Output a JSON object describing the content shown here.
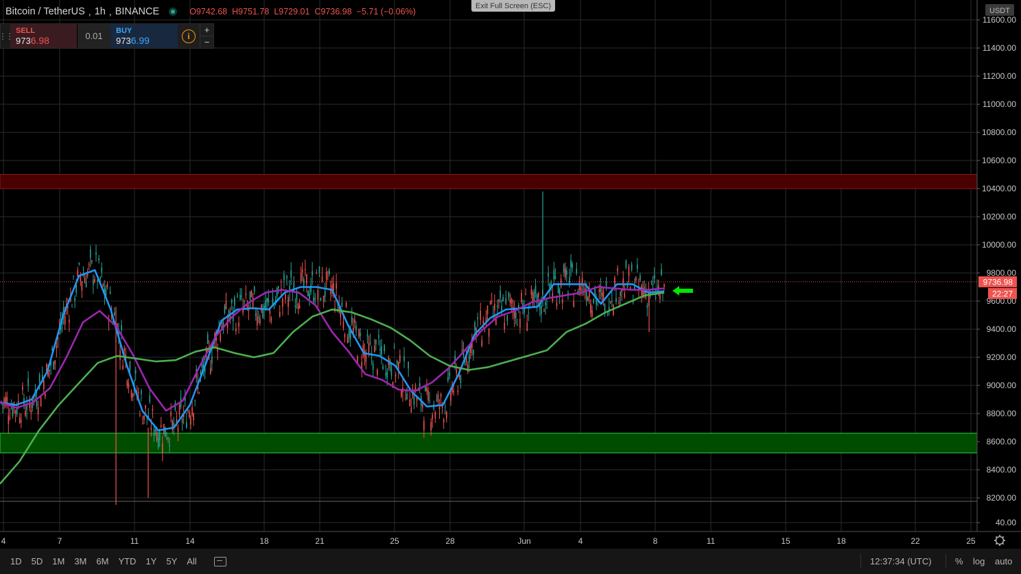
{
  "header": {
    "symbol": "Bitcoin / TetherUS",
    "interval": "1h",
    "exchange": "BINANCE",
    "ohlc": {
      "o_label": "O",
      "o": "9742.68",
      "h_label": "H",
      "h": "9751.78",
      "l_label": "L",
      "l": "9729.01",
      "c_label": "C",
      "c": "9736.98",
      "change": "−5.71 (−0.06%)"
    },
    "exit_fullscreen": "Exit Full Screen (ESC)"
  },
  "trade_panel": {
    "sell_label": "SELL",
    "sell_price_prefix": "973",
    "sell_price_suffix": "6.98",
    "quantity": "0.01",
    "buy_label": "BUY",
    "buy_price_prefix": "973",
    "buy_price_suffix": "6.99",
    "info_icon": "info-icon",
    "plus": "+",
    "minus": "−"
  },
  "price_axis": {
    "currency": "USDT",
    "current_price": "9736.98",
    "countdown": "22:27"
  },
  "bottom_bar": {
    "ranges": [
      "1D",
      "5D",
      "1M",
      "3M",
      "6M",
      "YTD",
      "1Y",
      "5Y",
      "All"
    ],
    "clock": "12:37:34 (UTC)",
    "percent": "%",
    "log": "log",
    "auto": "auto"
  },
  "colors": {
    "up": "#26a69a",
    "down": "#ef5350",
    "ma_fast": "#2196f3",
    "ma_mid": "#9c27b0",
    "ma_slow": "#4caf50",
    "resistance_zone": "#4a0000",
    "support_zone": "#004d00",
    "arrow": "#00e600"
  },
  "chart_data": {
    "type": "line",
    "ylim": [
      3820,
      11680
    ],
    "y_ticks": [
      "11600.00",
      "11400.00",
      "11200.00",
      "11000.00",
      "10800.00",
      "10600.00",
      "10400.00",
      "10200.00",
      "10000.00",
      "9800.00",
      "9600.00",
      "9400.00",
      "9200.00",
      "9000.00",
      "8800.00",
      "8600.00",
      "8400.00",
      "8200.00",
      "40.00"
    ],
    "x_ticks": [
      "4",
      "7",
      "11",
      "14",
      "18",
      "21",
      "25",
      "28",
      "Jun",
      "4",
      "8",
      "11",
      "15",
      "18",
      "22",
      "25"
    ],
    "zones": [
      {
        "from": 10400,
        "to": 10500,
        "type": "resistance"
      },
      {
        "from": 8520,
        "to": 8660,
        "type": "support"
      }
    ],
    "current_price": 9736.98,
    "series": [
      {
        "values": [
          8880,
          8860,
          8900,
          9100,
          9500,
          9780,
          9820,
          9540,
          9150,
          8820,
          8680,
          8700,
          8860,
          9150,
          9460,
          9540,
          9550,
          9540,
          9660,
          9700,
          9700,
          9680,
          9430,
          9230,
          9210,
          9140,
          8960,
          8850,
          8860,
          9080,
          9360,
          9480,
          9540,
          9550,
          9560,
          9720,
          9720,
          9720,
          9580,
          9720,
          9720,
          9660,
          9670
        ]
      },
      {
        "values": [
          8880,
          8840,
          8880,
          8980,
          9200,
          9450,
          9530,
          9420,
          9220,
          8980,
          8820,
          8890,
          9130,
          9350,
          9490,
          9590,
          9660,
          9680,
          9660,
          9570,
          9380,
          9240,
          9080,
          9040,
          8970,
          8960,
          9020,
          9120,
          9250,
          9390,
          9490,
          9530,
          9590,
          9620,
          9640,
          9660,
          9700,
          9690,
          9680,
          9680,
          9690
        ]
      },
      {
        "values": [
          8300,
          8460,
          8680,
          8860,
          9010,
          9160,
          9210,
          9190,
          9170,
          9180,
          9240,
          9270,
          9230,
          9200,
          9230,
          9380,
          9490,
          9540,
          9520,
          9470,
          9410,
          9320,
          9210,
          9140,
          9110,
          9130,
          9170,
          9210,
          9250,
          9380,
          9440,
          9520,
          9580,
          9640,
          9660
        ]
      }
    ]
  }
}
